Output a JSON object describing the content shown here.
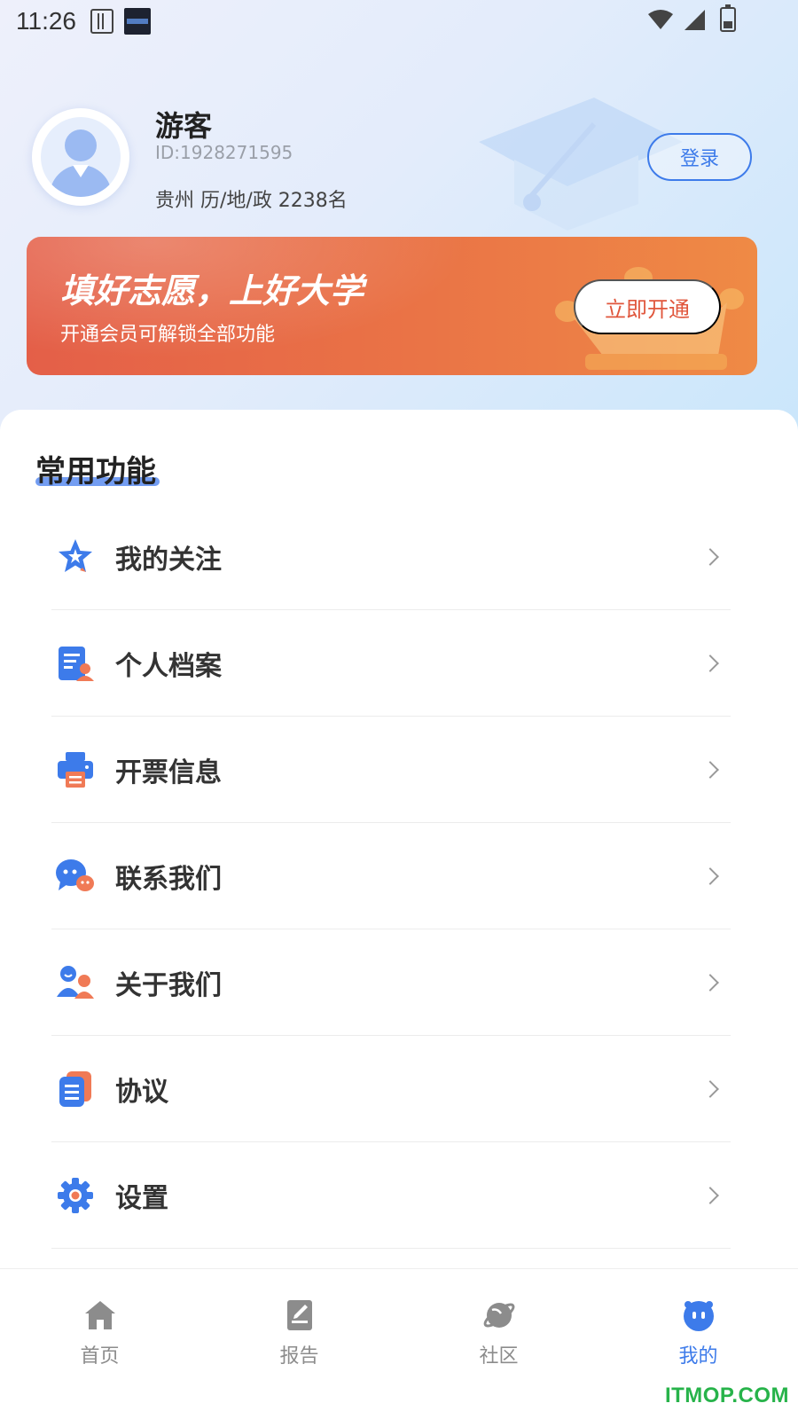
{
  "status_bar": {
    "time": "11:26"
  },
  "profile": {
    "name": "游客",
    "id": "ID:1928271595",
    "info": "贵州 历/地/政 2238名",
    "login_label": "登录"
  },
  "vip_banner": {
    "title": "填好志愿，上好大学",
    "subtitle": "开通会员可解锁全部功能",
    "button_label": "立即开通"
  },
  "section": {
    "title": "常用功能"
  },
  "menu": {
    "items": [
      {
        "label": "我的关注",
        "icon": "star-icon"
      },
      {
        "label": "个人档案",
        "icon": "profile-file-icon"
      },
      {
        "label": "开票信息",
        "icon": "printer-icon"
      },
      {
        "label": "联系我们",
        "icon": "chat-icon"
      },
      {
        "label": "关于我们",
        "icon": "team-icon"
      },
      {
        "label": "协议",
        "icon": "document-icon"
      },
      {
        "label": "设置",
        "icon": "gear-icon"
      }
    ]
  },
  "bottom_nav": {
    "items": [
      {
        "label": "首页",
        "icon": "home-icon"
      },
      {
        "label": "报告",
        "icon": "report-icon"
      },
      {
        "label": "社区",
        "icon": "planet-icon"
      },
      {
        "label": "我的",
        "icon": "face-icon",
        "active": true
      }
    ]
  },
  "watermark": "ITMOP.COM",
  "colors": {
    "accent_blue": "#3d7bea",
    "accent_orange": "#e9704a",
    "watermark_green": "#27b34a"
  }
}
